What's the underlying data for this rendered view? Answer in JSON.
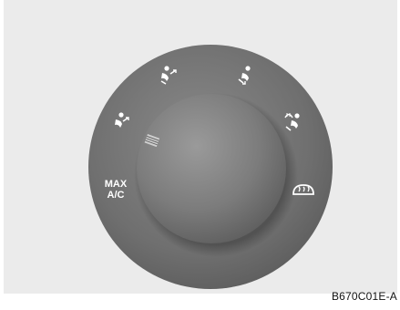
{
  "image_caption_code": "B670C01E-A",
  "control": {
    "positions": [
      {
        "icon": "face-vent-icon"
      },
      {
        "icon": "bi-level-vent-icon"
      },
      {
        "icon": "floor-vent-icon"
      },
      {
        "icon": "floor-defrost-vent-icon"
      },
      {
        "icon": "defrost-icon"
      }
    ],
    "max_ac_line1": "MAX",
    "max_ac_line2": "A/C",
    "pointer_icon": "dial-pointer-marker"
  },
  "colors": {
    "background": "#ebebeb",
    "ring": "#6e6e6e",
    "knob": "#7d7d7d",
    "icon": "#ffffff"
  }
}
